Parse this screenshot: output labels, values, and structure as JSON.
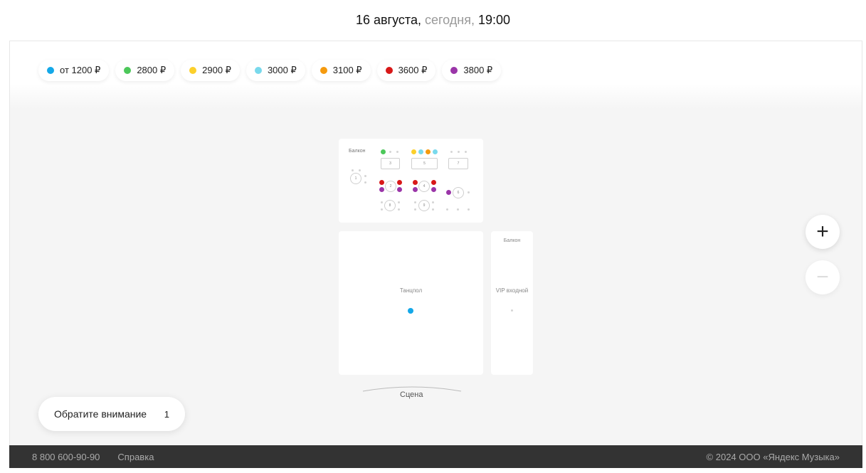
{
  "header": {
    "date": "16 августа,",
    "today": "сегодня,",
    "time": "19:00"
  },
  "legend": [
    {
      "label": "от 1200 ₽",
      "color": "#14a8e8"
    },
    {
      "label": "2800 ₽",
      "color": "#4cc85a"
    },
    {
      "label": "2900 ₽",
      "color": "#fcd02b"
    },
    {
      "label": "3000 ₽",
      "color": "#79d9ec"
    },
    {
      "label": "3100 ₽",
      "color": "#f59a0e"
    },
    {
      "label": "3600 ₽",
      "color": "#d81818"
    },
    {
      "label": "3800 ₽",
      "color": "#9a35a8"
    }
  ],
  "hall": {
    "balcony_left": "Балкон",
    "balcony_right": "Балкон",
    "dance_floor": "Танцпол",
    "vip": "VIP входной",
    "stage": "Сцена",
    "tables": [
      "1",
      "2",
      "3",
      "4",
      "5",
      "6",
      "7",
      "8",
      "9"
    ]
  },
  "zoom": {
    "plus": "+",
    "minus": "−"
  },
  "notice": {
    "label": "Обратите внимание",
    "count": "1"
  },
  "footer": {
    "phone": "8 800 600-90-90",
    "help": "Справка",
    "copyright": "© 2024 ООО «Яндекс Музыка»"
  }
}
